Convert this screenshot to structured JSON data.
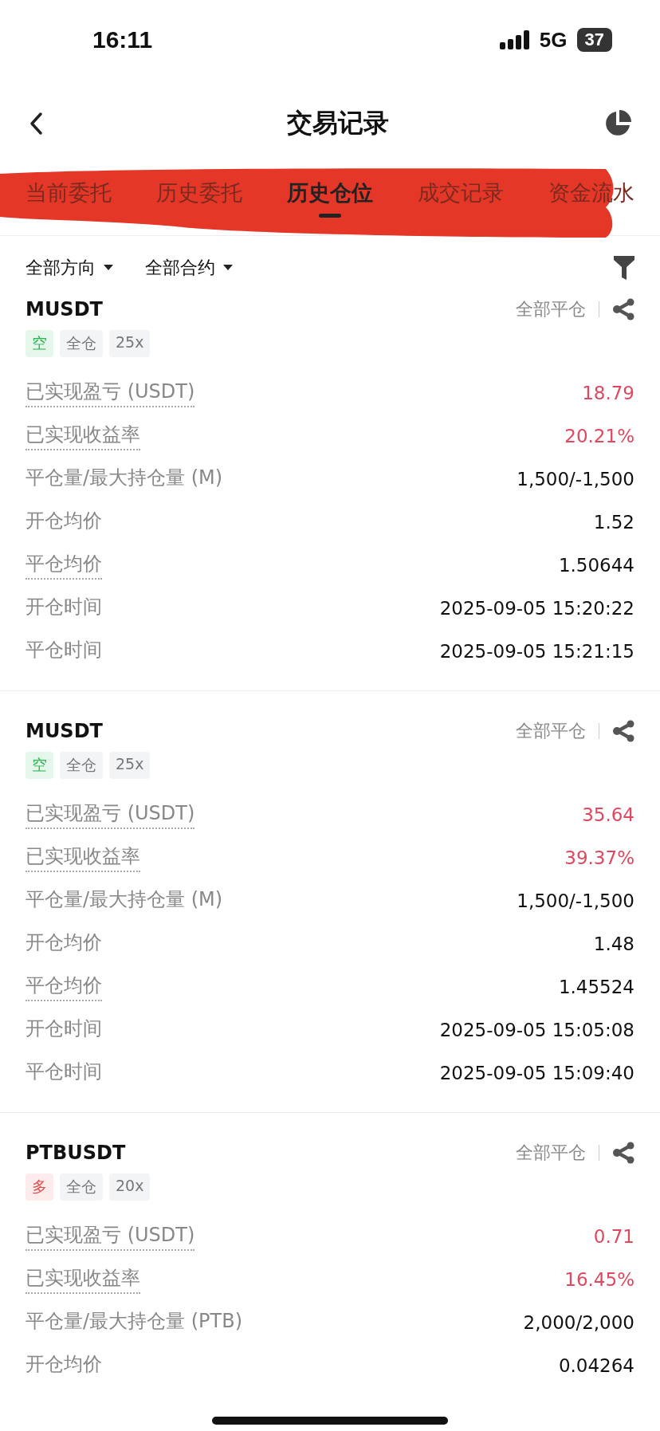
{
  "status_bar": {
    "time": "16:11",
    "network": "5G",
    "battery": "37"
  },
  "header": {
    "title": "交易记录"
  },
  "tabs": [
    {
      "label": "当前委托",
      "selected": false
    },
    {
      "label": "历史委托",
      "selected": false
    },
    {
      "label": "历史仓位",
      "selected": true
    },
    {
      "label": "成交记录",
      "selected": false
    },
    {
      "label": "资金流水",
      "selected": false
    }
  ],
  "filters": [
    "全部方向",
    "全部合约"
  ],
  "positions": [
    {
      "symbol": "MUSDT",
      "action": "全部平仓",
      "tags": [
        {
          "kind": "short",
          "label": "空"
        },
        {
          "kind": "plain",
          "label": "全仓"
        },
        {
          "kind": "plain",
          "label": "25x"
        }
      ],
      "rows": [
        {
          "label": "已实现盈亏 (USDT)",
          "dotted": true,
          "value": "18.79",
          "profit": true
        },
        {
          "label": "已实现收益率",
          "dotted": true,
          "value": "20.21%",
          "profit": true
        },
        {
          "label": "平仓量/最大持仓量 (M)",
          "dotted": false,
          "value": "1,500/-1,500",
          "profit": false
        },
        {
          "label": "开仓均价",
          "dotted": false,
          "value": "1.52",
          "profit": false
        },
        {
          "label": "平仓均价",
          "dotted": true,
          "value": "1.50644",
          "profit": false
        },
        {
          "label": "开仓时间",
          "dotted": false,
          "value": "2025-09-05 15:20:22",
          "profit": false
        },
        {
          "label": "平仓时间",
          "dotted": false,
          "value": "2025-09-05 15:21:15",
          "profit": false
        }
      ]
    },
    {
      "symbol": "MUSDT",
      "action": "全部平仓",
      "tags": [
        {
          "kind": "short",
          "label": "空"
        },
        {
          "kind": "plain",
          "label": "全仓"
        },
        {
          "kind": "plain",
          "label": "25x"
        }
      ],
      "rows": [
        {
          "label": "已实现盈亏 (USDT)",
          "dotted": true,
          "value": "35.64",
          "profit": true
        },
        {
          "label": "已实现收益率",
          "dotted": true,
          "value": "39.37%",
          "profit": true
        },
        {
          "label": "平仓量/最大持仓量 (M)",
          "dotted": false,
          "value": "1,500/-1,500",
          "profit": false
        },
        {
          "label": "开仓均价",
          "dotted": false,
          "value": "1.48",
          "profit": false
        },
        {
          "label": "平仓均价",
          "dotted": true,
          "value": "1.45524",
          "profit": false
        },
        {
          "label": "开仓时间",
          "dotted": false,
          "value": "2025-09-05 15:05:08",
          "profit": false
        },
        {
          "label": "平仓时间",
          "dotted": false,
          "value": "2025-09-05 15:09:40",
          "profit": false
        }
      ]
    },
    {
      "symbol": "PTBUSDT",
      "action": "全部平仓",
      "tags": [
        {
          "kind": "long",
          "label": "多"
        },
        {
          "kind": "plain",
          "label": "全仓"
        },
        {
          "kind": "plain",
          "label": "20x"
        }
      ],
      "rows": [
        {
          "label": "已实现盈亏 (USDT)",
          "dotted": true,
          "value": "0.71",
          "profit": true
        },
        {
          "label": "已实现收益率",
          "dotted": true,
          "value": "16.45%",
          "profit": true
        },
        {
          "label": "平仓量/最大持仓量 (PTB)",
          "dotted": false,
          "value": "2,000/2,000",
          "profit": false
        },
        {
          "label": "开仓均价",
          "dotted": false,
          "value": "0.04264",
          "profit": false
        }
      ]
    }
  ]
}
